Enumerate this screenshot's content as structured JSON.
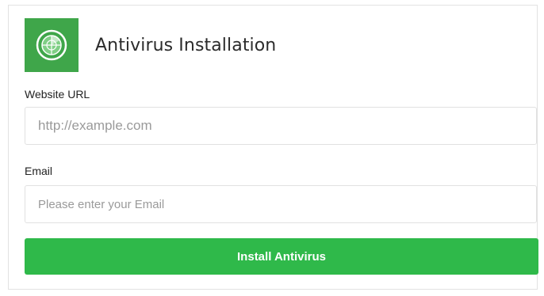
{
  "form": {
    "title": "Antivirus Installation",
    "logo_icon": "radar-shield-icon",
    "website_url": {
      "label": "Website URL",
      "value": "",
      "placeholder": "http://example.com"
    },
    "email": {
      "label": "Email",
      "value": "",
      "placeholder": "Please enter your Email"
    },
    "submit_label": "Install Antivirus"
  },
  "colors": {
    "logo_bg": "#3fa64a",
    "button_bg": "#2fb94a",
    "button_text": "#ffffff",
    "title_text": "#2b2b2b",
    "input_border": "#e1e1e1"
  }
}
